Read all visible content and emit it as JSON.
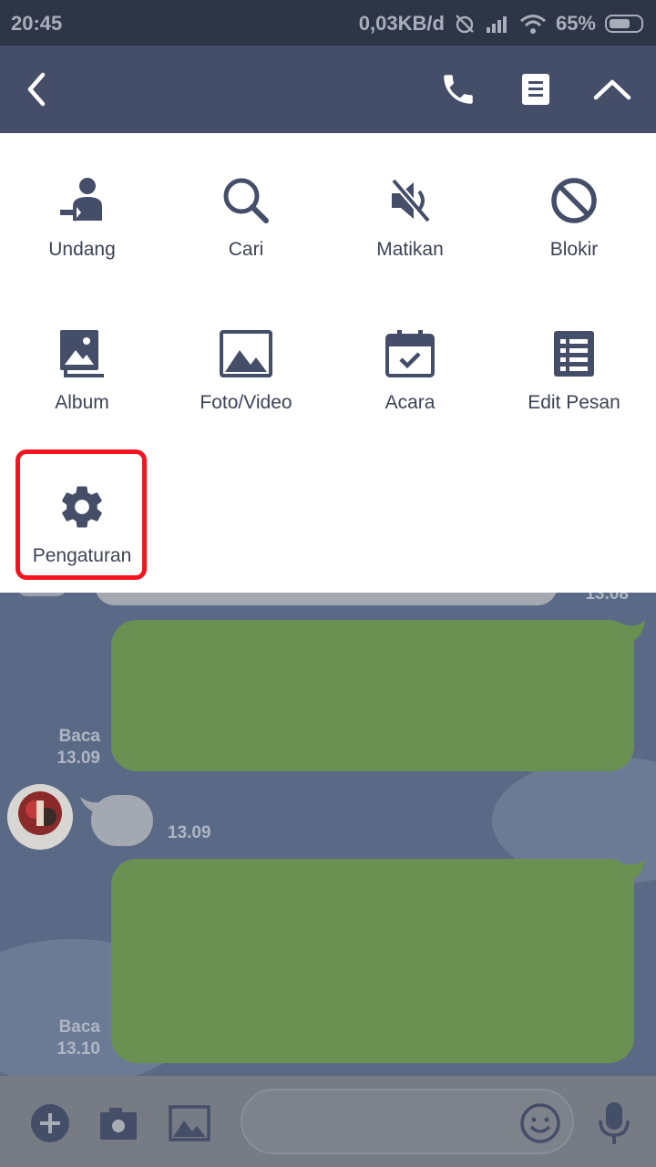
{
  "status": {
    "time": "20:45",
    "net_speed": "0,03KB/d",
    "battery": "65%"
  },
  "header": {
    "back_icon": "chevron-left-icon",
    "call_icon": "phone-icon",
    "notes_icon": "note-icon",
    "collapse_icon": "chevron-up-icon"
  },
  "menu": {
    "items": [
      {
        "label": "Undang",
        "icon": "invite-user-icon"
      },
      {
        "label": "Cari",
        "icon": "search-icon"
      },
      {
        "label": "Matikan",
        "icon": "mute-icon"
      },
      {
        "label": "Blokir",
        "icon": "block-icon"
      },
      {
        "label": "Album",
        "icon": "album-icon"
      },
      {
        "label": "Foto/Video",
        "icon": "image-icon"
      },
      {
        "label": "Acara",
        "icon": "calendar-icon"
      },
      {
        "label": "Edit Pesan",
        "icon": "list-icon"
      },
      {
        "label": "Pengaturan",
        "icon": "gear-icon"
      }
    ]
  },
  "chat": {
    "partial_time": "13.08",
    "msg1": {
      "read": "Baca",
      "time": "13.09"
    },
    "incoming_time": "13.09",
    "msg2": {
      "read": "Baca",
      "time": "13.10"
    }
  },
  "colors": {
    "header": "#454e69",
    "icon": "#454e69",
    "highlight": "#f5141e",
    "bubble": "#6a9152"
  }
}
